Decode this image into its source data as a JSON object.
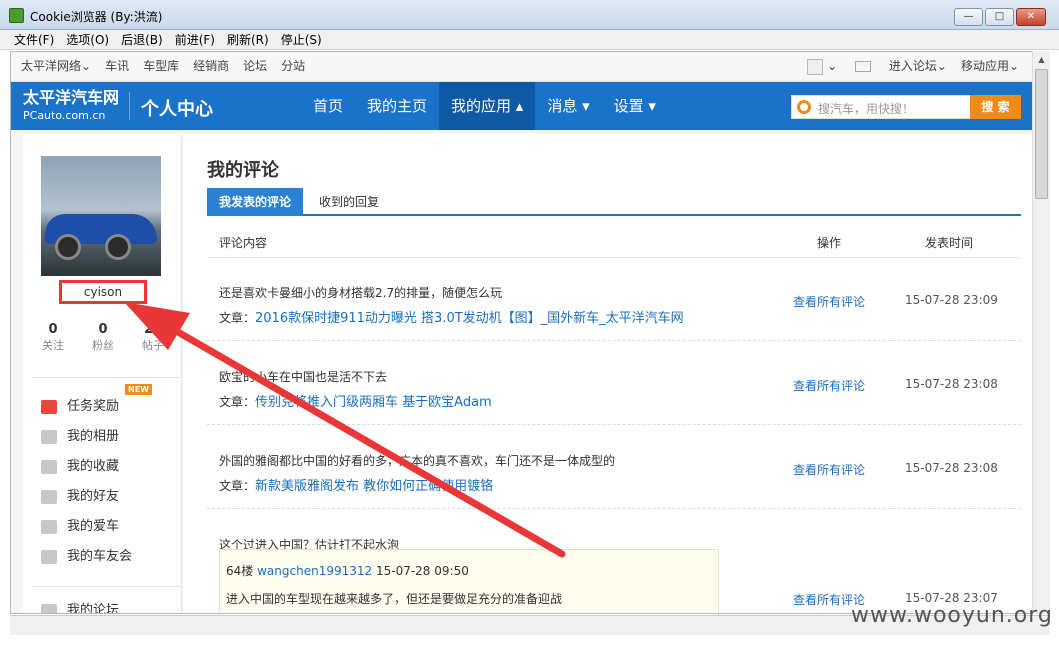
{
  "window": {
    "title": "Cookie浏览器 (By:洪流)",
    "min": "—",
    "max": "□",
    "close": "✕"
  },
  "menu": [
    "文件(F)",
    "选项(O)",
    "后退(B)",
    "前进(F)",
    "刷新(R)",
    "停止(S)"
  ],
  "topnav": {
    "left": [
      "太平洋网络⌄",
      "车讯",
      "车型库",
      "经销商",
      "论坛",
      "分站"
    ],
    "right": [
      "进入论坛⌄",
      "移动应用⌄"
    ],
    "avatar_caret": "⌄"
  },
  "header": {
    "logo": "太平洋汽车网",
    "logo_sub": "PCauto.com.cn",
    "center_title": "个人中心",
    "nav": [
      "首页",
      "我的主页",
      "我的应用 ▴",
      "消息 ▾",
      "设置 ▾"
    ],
    "search_placeholder": "搜汽车，用快搜！",
    "search_button": "搜 索"
  },
  "sidebar": {
    "username": "cyison",
    "stats": [
      {
        "value": "0",
        "label": "关注"
      },
      {
        "value": "0",
        "label": "粉丝"
      },
      {
        "value": "26",
        "label": "帖子"
      }
    ],
    "new_badge": "NEW",
    "items": [
      "任务奖励",
      "我的相册",
      "我的收藏",
      "我的好友",
      "我的爱车",
      "我的车友会",
      "我的论坛"
    ]
  },
  "content": {
    "title": "我的评论",
    "tabs": [
      "我发表的评论",
      "收到的回复"
    ],
    "columns": [
      "评论内容",
      "操作",
      "发表时间"
    ],
    "article_prefix": "文章：",
    "rows": [
      {
        "text": "还是喜欢卡曼细小的身材搭载2.7的排量，随便怎么玩",
        "article": "2016款保时捷911动力曝光 搭3.0T发动机【图】_国外新车_太平洋汽车网",
        "op": "查看所有评论",
        "time": "15-07-28 23:09"
      },
      {
        "text": "欧宝的小车在中国也是活不下去",
        "article": "传别克将推入门级两厢车 基于欧宝Adam",
        "op": "查看所有评论",
        "time": "15-07-28 23:08"
      },
      {
        "text": "外国的雅阁都比中国的好看的多，广本的真不喜欢，车门还不是一体成型的",
        "article": "新款美版雅阁发布 教你如何正确使用镀铬",
        "op": "查看所有评论",
        "time": "15-07-28 23:08"
      },
      {
        "text": "这个过进入中国？估计打不起水泡",
        "op": "查看所有评论",
        "time": "15-07-28 23:07"
      }
    ],
    "quote": {
      "floor": "64楼",
      "user": "wangchen1991312",
      "time": "15-07-28 09:50",
      "body": "进入中国的车型现在越来越多了，但还是要做足充分的准备迎战"
    }
  },
  "watermark": "www.wooyun.org",
  "colors": {
    "brand_blue": "#1a73c9",
    "active_nav": "#0f58a4",
    "search_orange": "#f08b16",
    "link_blue": "#1a6ec2",
    "annotation_red": "#e83737"
  }
}
